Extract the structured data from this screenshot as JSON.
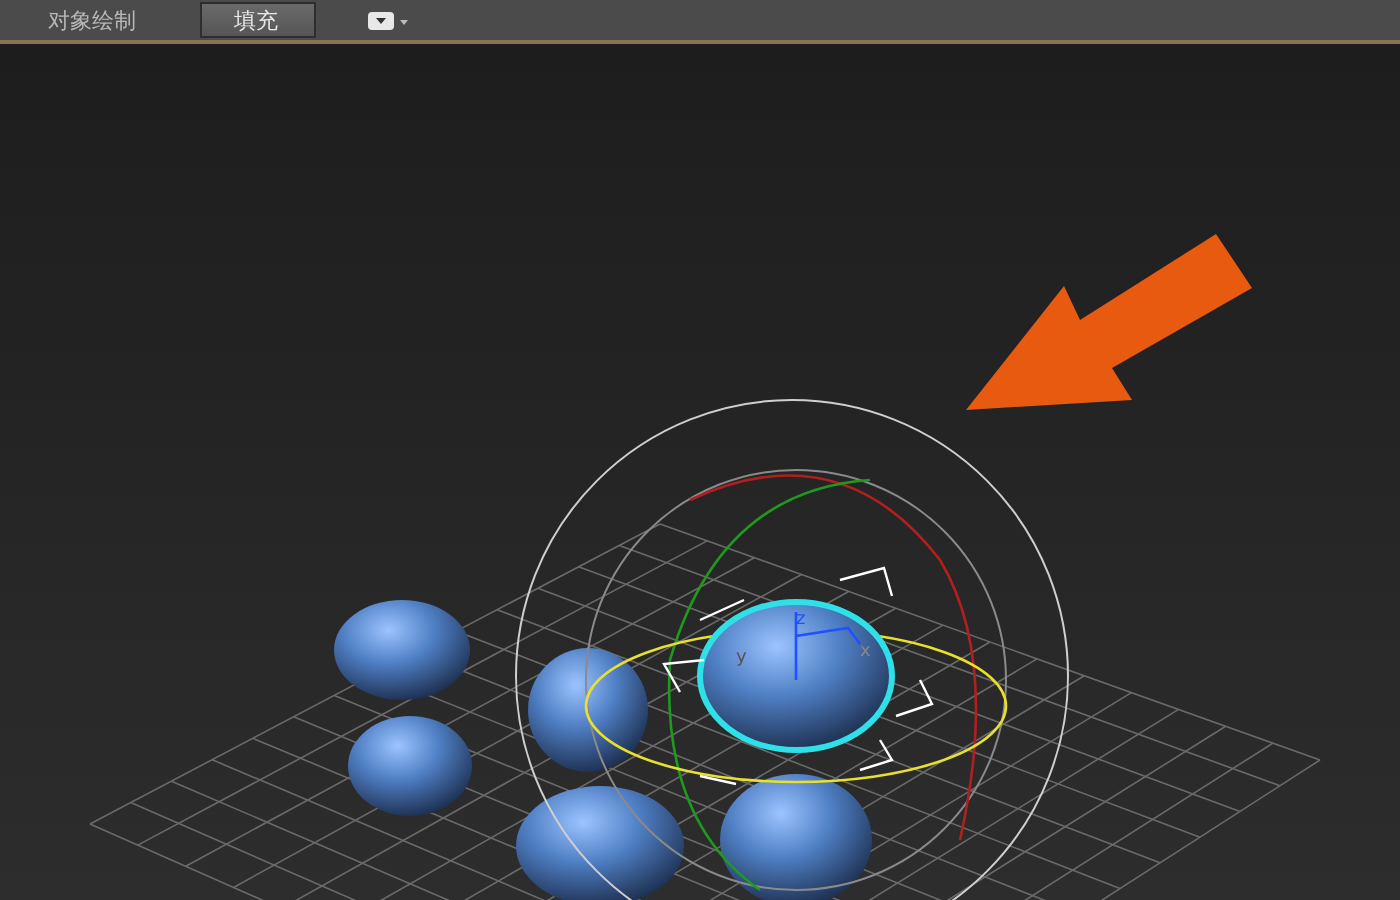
{
  "toolbar": {
    "label": "对象绘制",
    "tabs": [
      {
        "label": "填充",
        "selected": true
      }
    ]
  },
  "viewport": {
    "axis_labels": [
      "z",
      "y",
      "x"
    ]
  }
}
